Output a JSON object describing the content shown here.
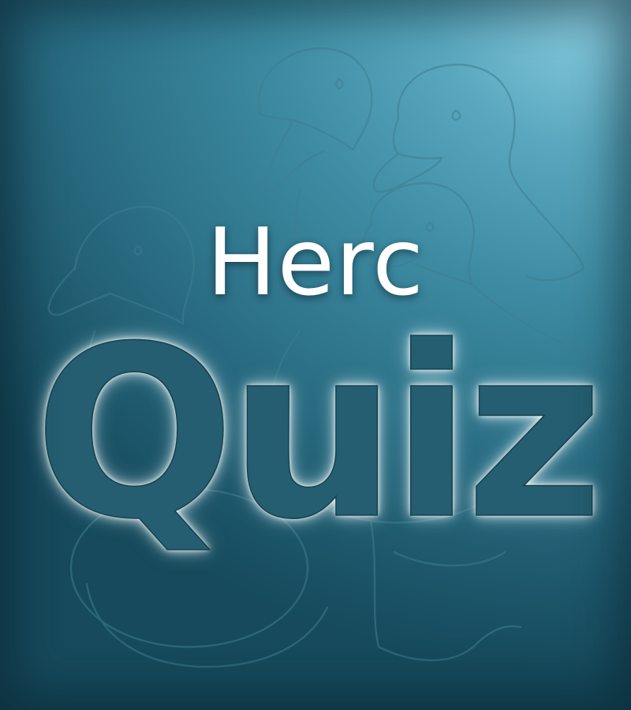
{
  "poster": {
    "title_small": "Herc",
    "title_big": "Quiz"
  },
  "colors": {
    "background_light": "#8fd1e3",
    "background_dark": "#164a5c",
    "title_small_color": "#ffffff",
    "title_big_fill": "#245e70",
    "title_big_glow": "#ffffff",
    "watermark_line": "#3f7d8f"
  },
  "watermark": {
    "subject": "duck-illustration"
  }
}
